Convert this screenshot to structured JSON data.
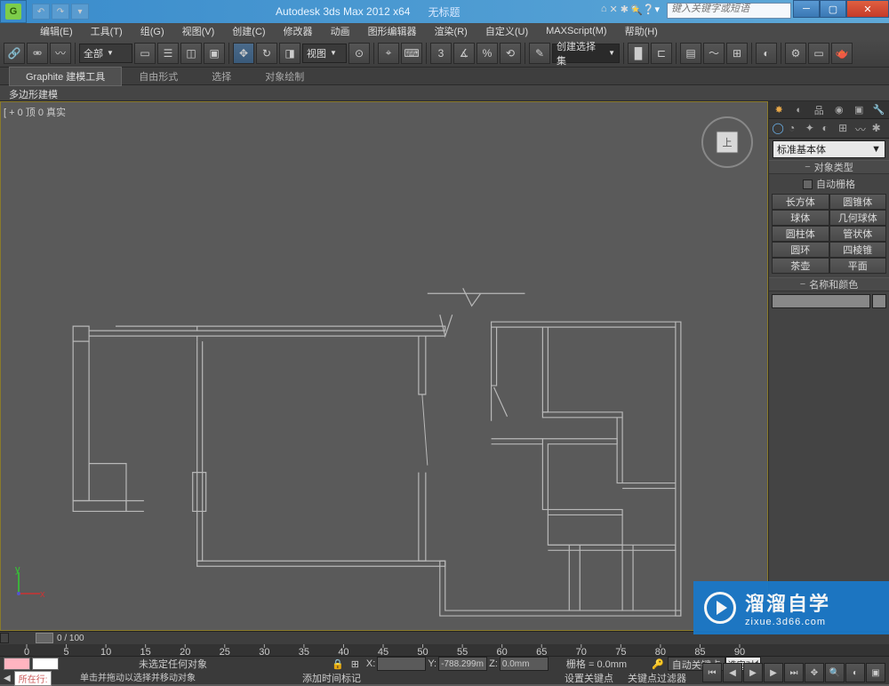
{
  "title": "Autodesk 3ds Max  2012 x64",
  "doc_name": "无标题",
  "search_placeholder": "键入关键字或短语",
  "menus": [
    "编辑(E)",
    "工具(T)",
    "组(G)",
    "视图(V)",
    "创建(C)",
    "修改器",
    "动画",
    "图形编辑器",
    "渲染(R)",
    "自定义(U)",
    "MAXScript(M)",
    "帮助(H)"
  ],
  "toolbar": {
    "filter_label": "全部",
    "view_label": "视图",
    "named_sel": "创建选择集"
  },
  "ribbon": {
    "title": "Graphite 建模工具",
    "tabs": [
      "自由形式",
      "选择",
      "对象绘制"
    ],
    "panel": "多边形建模"
  },
  "viewport_label": "[ + 0 顶 0 真实",
  "cmd_panel": {
    "dropdown": "标准基本体",
    "rollout1": "对象类型",
    "autogrid": "自动栅格",
    "prims": [
      "长方体",
      "圆锥体",
      "球体",
      "几何球体",
      "圆柱体",
      "管状体",
      "圆环",
      "四棱锥",
      "茶壶",
      "平面"
    ],
    "rollout2": "名称和颜色"
  },
  "timeline": {
    "frame_label": "0 / 100",
    "ticks": [
      0,
      5,
      10,
      15,
      20,
      25,
      30,
      35,
      40,
      45,
      50,
      55,
      60,
      65,
      70,
      75,
      80,
      85,
      90
    ]
  },
  "status": {
    "no_sel": "未选定任何对象",
    "hint": "单击并拖动以选择并移动对象",
    "row_label": "所在行:",
    "x": "X:",
    "y": "Y:",
    "y_val": "-788.299m",
    "z": "Z:",
    "z_val": "0.0mm",
    "grid": "栅格 = 0.0mm",
    "auto_key": "自动关键点",
    "sel_label": "选定对象",
    "set_key": "设置关键点",
    "key_filter": "关键点过滤器",
    "add_time": "添加时间标记"
  },
  "watermark": {
    "title": "溜溜自学",
    "sub": "zixue.3d66.com"
  }
}
